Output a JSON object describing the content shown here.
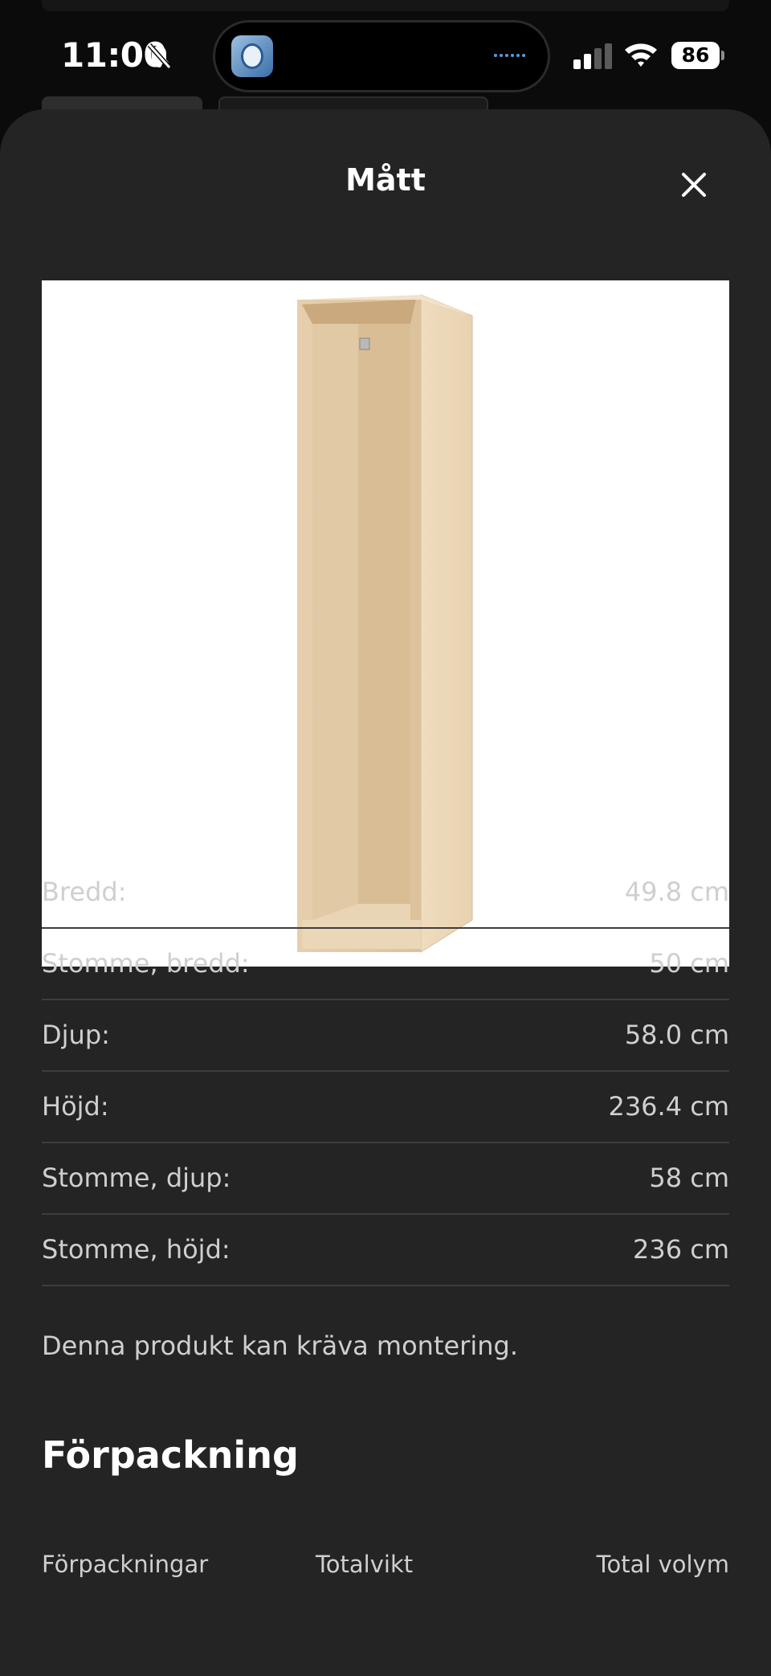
{
  "status_bar": {
    "time": "11:00",
    "battery": "86",
    "icons": [
      "bell-slash-icon",
      "signal-icon",
      "wifi-icon",
      "battery-icon"
    ]
  },
  "sheet": {
    "title": "Mått",
    "close_icon": "close-icon"
  },
  "measurements": [
    {
      "label": "Bredd:",
      "value": "49.8 cm"
    },
    {
      "label": "Stomme, bredd:",
      "value": "50 cm"
    },
    {
      "label": "Djup:",
      "value": "58.0 cm"
    },
    {
      "label": "Höjd:",
      "value": "236.4 cm"
    },
    {
      "label": "Stomme, djup:",
      "value": "58 cm"
    },
    {
      "label": "Stomme, höjd:",
      "value": "236 cm"
    }
  ],
  "assembly_note": "Denna produkt kan kräva montering.",
  "packaging": {
    "heading": "Förpackning",
    "columns": [
      "Förpackningar",
      "Totalvikt",
      "Total volym"
    ]
  },
  "colors": {
    "sheet_background": "#242424",
    "divider": "#3d3d3d",
    "text_muted": "#cfcfcf"
  }
}
